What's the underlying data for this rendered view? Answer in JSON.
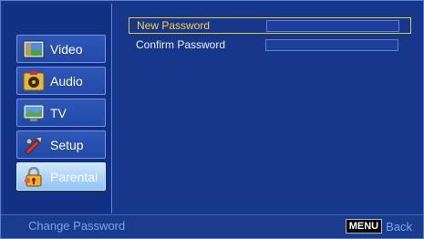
{
  "sidebar": {
    "items": [
      {
        "label": "Video",
        "icon": "video-icon",
        "active": false
      },
      {
        "label": "Audio",
        "icon": "audio-icon",
        "active": false
      },
      {
        "label": "TV",
        "icon": "tv-icon",
        "active": false
      },
      {
        "label": "Setup",
        "icon": "setup-icon",
        "active": false
      },
      {
        "label": "Parental",
        "icon": "parental-lock-icon",
        "active": true
      }
    ]
  },
  "form": {
    "new_password_label": "New Password",
    "new_password_value": "",
    "confirm_password_label": "Confirm Password",
    "confirm_password_value": "",
    "focused_field": "new_password"
  },
  "status_bar": {
    "text": "Change Password",
    "menu_key": "MENU",
    "back_label": "Back"
  },
  "colors": {
    "background": "#16378c",
    "focus_border": "#e6cd2a",
    "focus_text": "#ffd338",
    "active_item": "#8ec3f5",
    "status_text": "#7fa2f0"
  }
}
